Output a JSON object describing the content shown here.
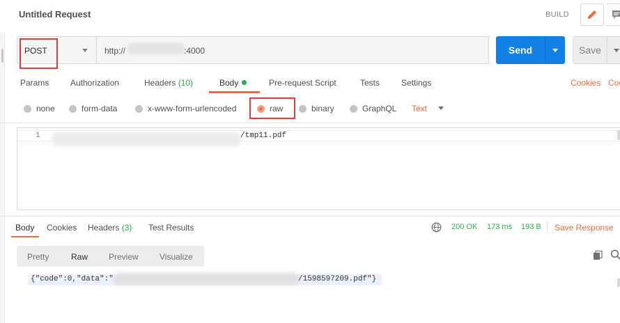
{
  "header": {
    "title": "Untitled Request",
    "build_label": "BUILD"
  },
  "request": {
    "method": "POST",
    "url_prefix": "http://",
    "url_suffix": ":4000",
    "send_label": "Send",
    "save_label": "Save"
  },
  "tabs": {
    "params": "Params",
    "authorization": "Authorization",
    "headers": "Headers",
    "headers_count": "(10)",
    "body": "Body",
    "pre_request": "Pre-request Script",
    "tests": "Tests",
    "settings": "Settings",
    "cookies": "Cookies",
    "code": "Cod"
  },
  "body_types": {
    "none": "none",
    "form_data": "form-data",
    "urlencoded": "x-www-form-urlencoded",
    "raw": "raw",
    "binary": "binary",
    "graphql": "GraphQL",
    "selected": "raw",
    "text_type": "Text"
  },
  "editor": {
    "line_number": "1",
    "line_text": "/tmp11.pdf"
  },
  "response": {
    "tabs": {
      "body": "Body",
      "cookies": "Cookies",
      "headers": "Headers",
      "headers_count": "(3)",
      "test_results": "Test Results"
    },
    "status": "200 OK",
    "time": "173 ms",
    "size": "193 B",
    "save_response": "Save Response",
    "views": {
      "pretty": "Pretty",
      "raw": "Raw",
      "preview": "Preview",
      "visualize": "Visualize"
    },
    "text_start": "{\"code\":0,\"data\":\"",
    "text_end": "/1598597209.pdf\"}"
  },
  "colors": {
    "accent": "#f26b3a",
    "send_blue": "#1280e4",
    "success_green": "#26b047",
    "highlight_red": "#e03b3b"
  },
  "icons": [
    "pencil-icon",
    "comment-icon",
    "globe-icon",
    "copy-icon",
    "search-icon"
  ]
}
